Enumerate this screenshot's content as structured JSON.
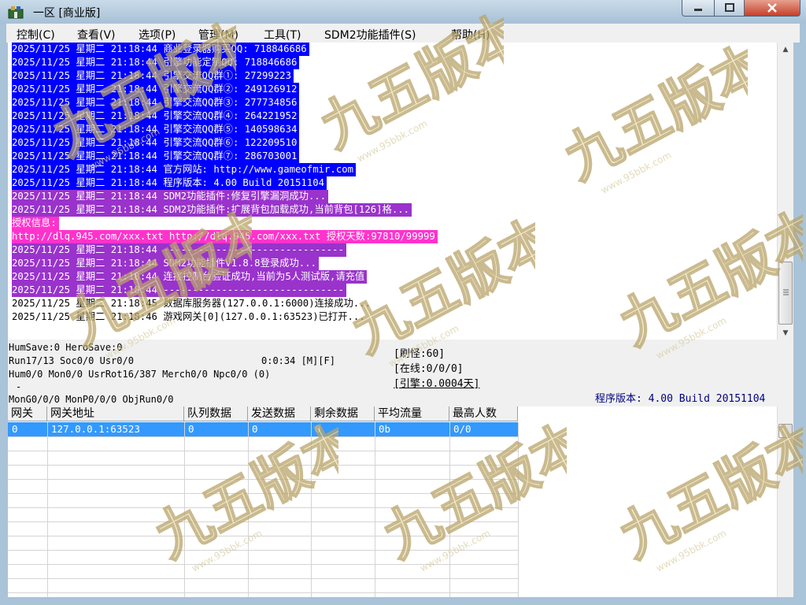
{
  "window": {
    "title": "一区 [商业版]"
  },
  "menu": [
    "控制(C)",
    "查看(V)",
    "选项(P)",
    "管理(M)",
    "工具(T)",
    "SDM2功能插件(S)",
    "帮助(H)"
  ],
  "colors": {
    "blue_hl": "#0000ff",
    "purple_hl": "#9933cc",
    "magenta_hl": "#ff33cc",
    "row_sel": "#3399ff",
    "version_text": "#000080"
  },
  "log": [
    {
      "text": "2025/11/25 星期二 21:18:44 商业登录器购买QQ: 718846686",
      "hl": "blue"
    },
    {
      "text": "2025/11/25 星期二 21:18:44 引擎功能定制QQ: 718846686",
      "hl": "blue"
    },
    {
      "text": "2025/11/25 星期二 21:18:44 引擎交流QQ群①: 27299223",
      "hl": "blue"
    },
    {
      "text": "2025/11/25 星期二 21:18:44 引擎交流QQ群②: 249126912",
      "hl": "blue"
    },
    {
      "text": "2025/11/25 星期二 21:18:44 引擎交流QQ群③: 277734856",
      "hl": "blue"
    },
    {
      "text": "2025/11/25 星期二 21:18:44 引擎交流QQ群④: 264221952",
      "hl": "blue"
    },
    {
      "text": "2025/11/25 星期二 21:18:44 引擎交流QQ群⑤: 140598634",
      "hl": "blue"
    },
    {
      "text": "2025/11/25 星期二 21:18:44 引擎交流QQ群⑥: 122209510",
      "hl": "blue"
    },
    {
      "text": "2025/11/25 星期二 21:18:44 引擎交流QQ群⑦: 286703001",
      "hl": "blue"
    },
    {
      "text": "2025/11/25 星期二 21:18:44 官方网站: http://www.gameofmir.com",
      "hl": "blue"
    },
    {
      "text": "2025/11/25 星期二 21:18:44 程序版本: 4.00 Build 20151104",
      "hl": "blue"
    },
    {
      "text": "2025/11/25 星期二 21:18:44 SDM2功能插件:修复引擎漏洞成功...",
      "hl": "purple"
    },
    {
      "text": "2025/11/25 星期二 21:18:44 SDM2功能插件:扩展背包加载成功,当前背包[126]格...",
      "hl": "purple"
    },
    {
      "text": "授权信息:",
      "hl": "magenta"
    },
    {
      "text": "http://dlq.945.com/xxx.txt http://dlq.945.com/xxx.txt 授权天数:97810/99999",
      "hl": "magenta"
    },
    {
      "text": "2025/11/25 星期二 21:18:44 -------------------------------",
      "hl": "purple"
    },
    {
      "text": "2025/11/25 星期二 21:18:44 SDM2功能插件V1.8.8登录成功...",
      "hl": "purple"
    },
    {
      "text": "2025/11/25 星期二 21:18:44 连接控制台验证成功,当前为5人测试版,请充值",
      "hl": "purple"
    },
    {
      "text": "2025/11/25 星期二 21:18:44 -------------------------------",
      "hl": "purple"
    },
    {
      "text": "2025/11/25 星期二 21:18:45 数据库服务器(127.0.0.1:6000)连接成功...",
      "hl": "none"
    },
    {
      "text": "2025/11/25 星期二 21:18:46 游戏网关[0](127.0.0.1:63523)已打开...",
      "hl": "none"
    }
  ],
  "status": {
    "hum_save": "HumSave:0 HeroSave:0",
    "run": "Run17/13 Soc0/0 Usr0/0",
    "timer": "0:0:34 [M][F]",
    "hum": "Hum0/0 Mon0/0 UsrRot16/387 Merch0/0 Npc0/0 (0)",
    "dash": "-",
    "mon": "MonG0/0/0 MonP0/0/0 ObjRun0/0",
    "refresh": "[刷怪:60]",
    "online": "[在线:0/0/0]",
    "engine": "[引擎:0.0004天]",
    "version": "程序版本: 4.00 Build 20151104"
  },
  "table": {
    "headers": [
      "网关",
      "网关地址",
      "队列数据",
      "发送数据",
      "剩余数据",
      "平均流量",
      "最高人数"
    ],
    "rows": [
      [
        "0",
        "127.0.0.1:63523",
        "0",
        "0",
        "0",
        "0b",
        "0/0"
      ]
    ]
  },
  "watermark": {
    "brand": "九五版本库",
    "url": "www.95bbk.com"
  },
  "icons": [
    "app-icon",
    "minimize-icon",
    "maximize-icon",
    "close-icon",
    "scroll-up-icon",
    "scroll-down-icon"
  ]
}
